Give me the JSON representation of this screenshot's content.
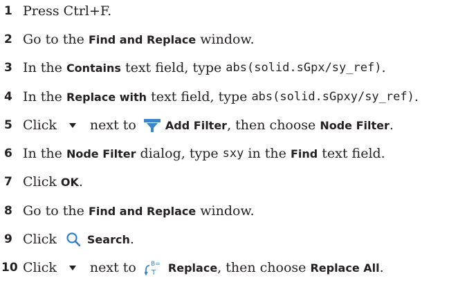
{
  "steps": [
    {
      "n": "1",
      "t1": "Press Ctrl+F."
    },
    {
      "n": "2",
      "t1": "Go to the ",
      "b1": "Find and Replace",
      "t2": " window."
    },
    {
      "n": "3",
      "t1": "In the ",
      "b1": "Contains",
      "t2": " text field, type ",
      "c1": "abs(solid.sGpx/sy_ref)",
      "t3": "."
    },
    {
      "n": "4",
      "t1": "In the ",
      "b1": "Replace with",
      "t2": " text field, type ",
      "c1": "abs(solid.sGpxy/sy_ref)",
      "t3": "."
    },
    {
      "n": "5",
      "t1": "Click ",
      "t2": " next to ",
      "b1": "Add Filter",
      "t3": ", then choose ",
      "b2": "Node Filter",
      "t4": "."
    },
    {
      "n": "6",
      "t1": "In the ",
      "b1": "Node Filter",
      "t2": " dialog, type ",
      "c1": "sxy",
      "t3": " in the ",
      "b2": "Find",
      "t4": " text field."
    },
    {
      "n": "7",
      "t1": "Click ",
      "b1": "OK",
      "t2": "."
    },
    {
      "n": "8",
      "t1": "Go to the ",
      "b1": "Find and Replace",
      "t2": " window."
    },
    {
      "n": "9",
      "t1": "Click ",
      "b1": "Search",
      "t2": "."
    },
    {
      "n": "10",
      "t1": "Click ",
      "t2": " next to ",
      "b1": "Replace",
      "t3": ", then choose ",
      "b2": "Replace All",
      "t4": "."
    }
  ],
  "icons": {
    "dropdown": "dropdown-triangle-icon",
    "filter": "add-filter-icon",
    "search": "search-icon",
    "replace": "replace-icon"
  },
  "colors": {
    "text": "#231f20",
    "filter_blue": "#3a86c8",
    "search_blue": "#2a7fd4"
  }
}
